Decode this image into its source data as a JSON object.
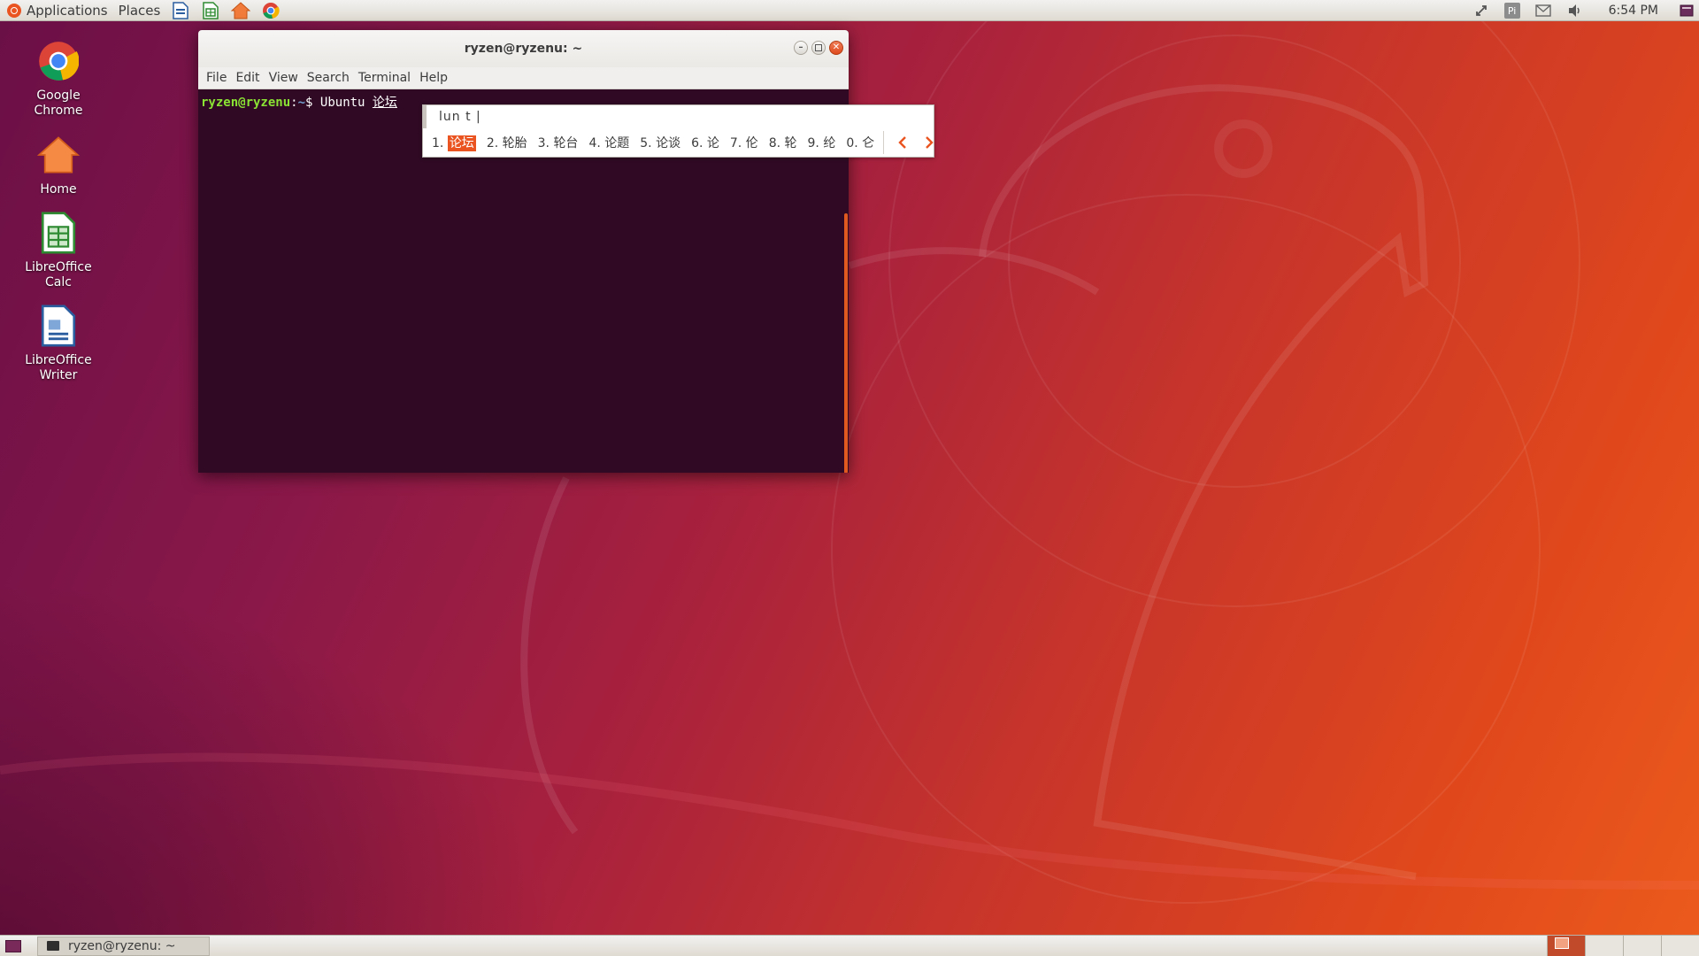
{
  "top_panel": {
    "applications_label": "Applications",
    "places_label": "Places",
    "clock": "6:54 PM",
    "tray": {
      "input_method_label": "Pi"
    }
  },
  "desktop_icons": [
    {
      "label": "Google Chrome",
      "icon": "chrome-icon"
    },
    {
      "label": "Home",
      "icon": "home-folder-icon"
    },
    {
      "label": "LibreOffice Calc",
      "icon": "calc-icon"
    },
    {
      "label": "LibreOffice Writer",
      "icon": "writer-icon"
    }
  ],
  "terminal": {
    "title": "ryzen@ryzenu: ~",
    "menu": [
      "File",
      "Edit",
      "View",
      "Search",
      "Terminal",
      "Help"
    ],
    "prompt_user": "ryzen@ryzenu",
    "prompt_sep": ":",
    "prompt_path": "~",
    "prompt_symbol": "$",
    "typed_text": "Ubuntu",
    "preedit_text": "论坛"
  },
  "ime": {
    "input_text": "lun t |",
    "candidates": [
      {
        "index": "1.",
        "text": "论坛"
      },
      {
        "index": "2.",
        "text": "轮胎"
      },
      {
        "index": "3.",
        "text": "轮台"
      },
      {
        "index": "4.",
        "text": "论题"
      },
      {
        "index": "5.",
        "text": "论谈"
      },
      {
        "index": "6.",
        "text": "论"
      },
      {
        "index": "7.",
        "text": "伦"
      },
      {
        "index": "8.",
        "text": "轮"
      },
      {
        "index": "9.",
        "text": "纶"
      },
      {
        "index": "0.",
        "text": "仑"
      }
    ],
    "selected_index": 0,
    "accent_color": "#e95420"
  },
  "bottom_panel": {
    "taskbar_item_label": "ryzen@ryzenu: ~"
  },
  "colors": {
    "terminal_bg": "#300a24",
    "prompt_user": "#8ae234",
    "prompt_path": "#729fcf",
    "accent": "#e95420"
  }
}
